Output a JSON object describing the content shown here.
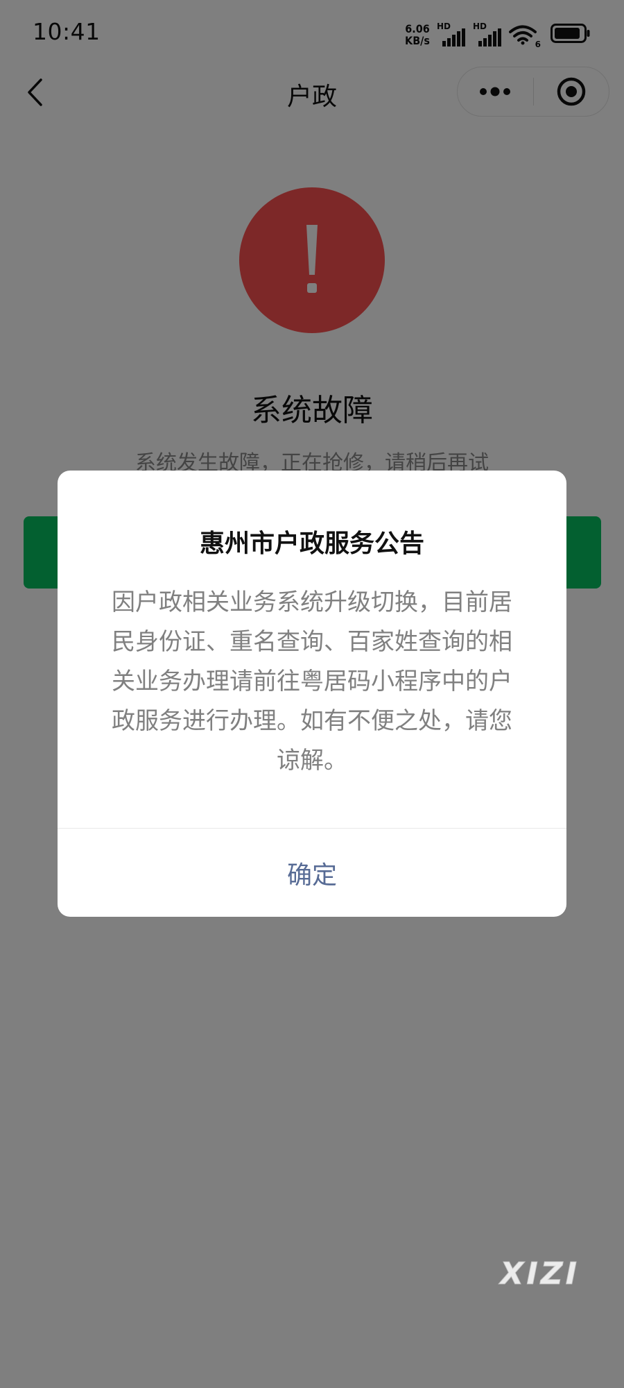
{
  "status_bar": {
    "time": "10:41",
    "net_speed_value": "6.06",
    "net_speed_unit": "KB/s",
    "sim1_label": "HD",
    "sim2_label": "HD",
    "wifi_label": "6",
    "icons": [
      "signal-icon",
      "signal-icon",
      "wifi-icon",
      "battery-icon"
    ]
  },
  "nav": {
    "title": "户政",
    "back_icon": "chevron-left-icon",
    "more_icon": "more-dots-icon",
    "close_icon": "target-circle-icon"
  },
  "error": {
    "icon": "exclamation-icon",
    "title": "系统故障",
    "description": "系统发生故障，正在抢修，请稍后再试",
    "button_label": ""
  },
  "dialog": {
    "title": "惠州市户政服务公告",
    "body": "因户政相关业务系统升级切换，目前居民身份证、重名查询、百家姓查询的相关业务办理请前往粤居码小程序中的户政服务进行办理。如有不便之处，请您谅解。",
    "confirm_label": "确定"
  },
  "watermark": "XIZI",
  "colors": {
    "error_red": "#fa5151",
    "primary_green": "#07c160",
    "link_blue": "#576b95",
    "mask": "rgba(0,0,0,0.5)"
  }
}
